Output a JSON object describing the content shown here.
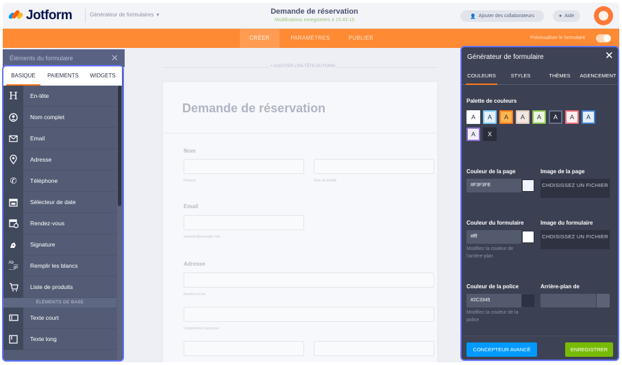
{
  "topbar": {
    "logo_text": "Jotform",
    "breadcrumb": "Générateur de formulaires",
    "form_title": "Demande de réservation",
    "form_saved": "Modifications enregistrées à 15:43:19",
    "collab_label": "Ajouter des collaborateurs",
    "help_label": "Aide"
  },
  "nav": {
    "tabs": [
      "CRÉER",
      "PARAMÈTRES",
      "PUBLIER"
    ],
    "preview_label": "Prévisualiser le formulaire"
  },
  "canvas": {
    "add_text": "+ AJOUTER L'EN-TÊTE DU FORM",
    "card_title": "Demande de réservation",
    "fields": {
      "name_label": "Nom",
      "first_sub": "Prénom",
      "last_sub": "Nom de famille",
      "email_label": "Email",
      "email_sub": "example@example.com",
      "address_label": "Adresse",
      "street_sub": "Numéro et rue",
      "street2_sub": "Complément d'adresse"
    }
  },
  "left_panel": {
    "header_title": "Éléments du formulaire",
    "tabs": [
      "BASIQUE",
      "PAIEMENTS",
      "WIDGETS"
    ],
    "items": [
      {
        "label": "En-tête",
        "icon": "heading-icon"
      },
      {
        "label": "Nom complet",
        "icon": "user-icon"
      },
      {
        "label": "Email",
        "icon": "envelope-icon"
      },
      {
        "label": "Adresse",
        "icon": "map-pin-icon"
      },
      {
        "label": "Téléphone",
        "icon": "phone-icon"
      },
      {
        "label": "Sélecteur de date",
        "icon": "calendar-icon"
      },
      {
        "label": "Rendez-vous",
        "icon": "appointment-icon"
      },
      {
        "label": "Signature",
        "icon": "pen-icon"
      },
      {
        "label": "Remplir les blancs",
        "icon": "fill-blanks-icon"
      },
      {
        "label": "Liste de produits",
        "icon": "cart-icon"
      }
    ],
    "section_label": "ÉLÉMENTS DE BASE",
    "base_items": [
      {
        "label": "Texte court",
        "icon": "short-text-icon"
      },
      {
        "label": "Texte long",
        "icon": "long-text-icon"
      }
    ]
  },
  "right_panel": {
    "title": "Générateur de formulaire",
    "tabs": [
      "COULEURS",
      "STYLES",
      "THÈMES",
      "AGENCEMENT"
    ],
    "palette_title": "Palette de couleurs",
    "palette": [
      {
        "text": "A",
        "bg": "#ffffff",
        "fg": "#2c3345",
        "border": "#ffffff"
      },
      {
        "text": "A",
        "bg": "#e3f2fd",
        "fg": "#2c3345",
        "border": "#7ec8f5"
      },
      {
        "text": "A",
        "bg": "#ffb74d",
        "fg": "#2c3345",
        "border": "#ff7a1a"
      },
      {
        "text": "A",
        "bg": "#f2e6de",
        "fg": "#2c3345",
        "border": "#dccabd"
      },
      {
        "text": "A",
        "bg": "#eaf6e0",
        "fg": "#2c3345",
        "border": "#8bc34a"
      },
      {
        "text": "A",
        "bg": "#2d3245",
        "fg": "#ffffff",
        "border": "#6a7088"
      },
      {
        "text": "A",
        "bg": "#fdeef0",
        "fg": "#2c3345",
        "border": "#ef6b7a"
      },
      {
        "text": "A",
        "bg": "#dff0fb",
        "fg": "#2c3345",
        "border": "#3f7fd0"
      },
      {
        "text": "A",
        "bg": "#f1eefa",
        "fg": "#2c3345",
        "border": "#8a6fd1"
      },
      {
        "text": "X",
        "bg": "#2a2e3c",
        "fg": "#ffffff",
        "border": "#2a2e3c"
      }
    ],
    "page_color_label": "Couleur de la page",
    "page_color_value": "#F3F3FE",
    "page_color_hex": "#f3f3fe",
    "page_image_label": "Image de la page",
    "choose_file": "CHOISISSEZ UN FICHIER",
    "form_color_label": "Couleur du formulaire",
    "form_color_value": "#fff",
    "form_color_hex": "#ffffff",
    "form_image_label": "Image du formulaire",
    "form_color_hint": "Modifiez la couleur de l'arrière-plan",
    "font_color_label": "Couleur de la police",
    "font_color_value": "#2C3345",
    "font_color_hex": "#2c3345",
    "font_color_hint": "Modifiez la couleur de la police",
    "background_label": "Arrière-plan de",
    "advanced_button": "CONCEPTEUR AVANCÉ",
    "save_button": "ENREGISTRER"
  }
}
